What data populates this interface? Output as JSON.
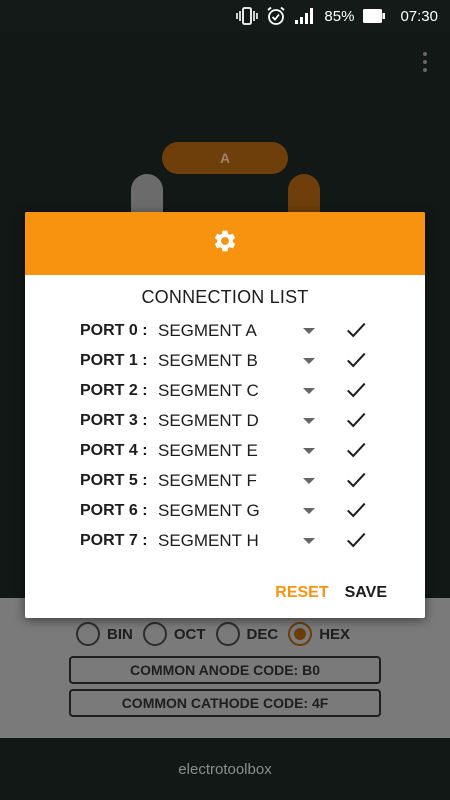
{
  "status_bar": {
    "battery_percent": "85%",
    "time": "07:30",
    "icons": [
      "vibrate-icon",
      "alarm-icon",
      "signal-icon",
      "battery-icon"
    ]
  },
  "display": {
    "segment_a_label": "A"
  },
  "dialog": {
    "header_icon": "gear-icon",
    "title": "CONNECTION LIST",
    "rows": [
      {
        "port": "PORT 0 :",
        "segment": "SEGMENT A"
      },
      {
        "port": "PORT 1 :",
        "segment": "SEGMENT B"
      },
      {
        "port": "PORT 2 :",
        "segment": "SEGMENT C"
      },
      {
        "port": "PORT 3 :",
        "segment": "SEGMENT D"
      },
      {
        "port": "PORT 4 :",
        "segment": "SEGMENT E"
      },
      {
        "port": "PORT 5 :",
        "segment": "SEGMENT F"
      },
      {
        "port": "PORT 6 :",
        "segment": "SEGMENT G"
      },
      {
        "port": "PORT 7 :",
        "segment": "SEGMENT H"
      }
    ],
    "reset_label": "RESET",
    "save_label": "SAVE"
  },
  "format_options": {
    "options": [
      "BIN",
      "OCT",
      "DEC",
      "HEX"
    ],
    "selected": "HEX"
  },
  "codes": {
    "common_anode": "COMMON ANODE CODE: B0",
    "common_cathode": "COMMON CATHODE CODE: 4F"
  },
  "footer": {
    "text": "electrotoolbox"
  },
  "colors": {
    "accent": "#f7930e",
    "background": "#111816"
  }
}
